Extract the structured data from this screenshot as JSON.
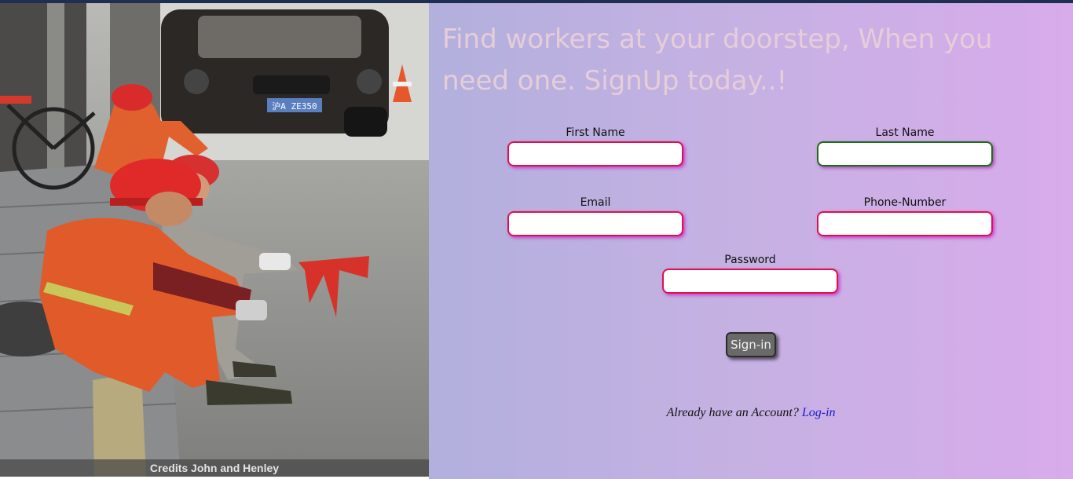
{
  "hero": {
    "credits": "Credits John and Henley",
    "plate_text": "沪A ZE350"
  },
  "headline": "Find workers at your doorstep, When you need one. SignUp today..!",
  "form": {
    "first_name_label": "First Name",
    "last_name_label": "Last Name",
    "email_label": "Email",
    "phone_label": "Phone-Number",
    "password_label": "Password",
    "first_name_value": "",
    "last_name_value": "",
    "email_value": "",
    "phone_value": "",
    "password_value": "",
    "signin_label": "Sign-in"
  },
  "login": {
    "prompt": "Already have an Account?",
    "link_label": "Log-in"
  },
  "colors": {
    "invalid_border": "#e0104a",
    "valid_border": "#1a6e1a",
    "link": "#1a1ad0",
    "headline": "#e6cdd8"
  }
}
